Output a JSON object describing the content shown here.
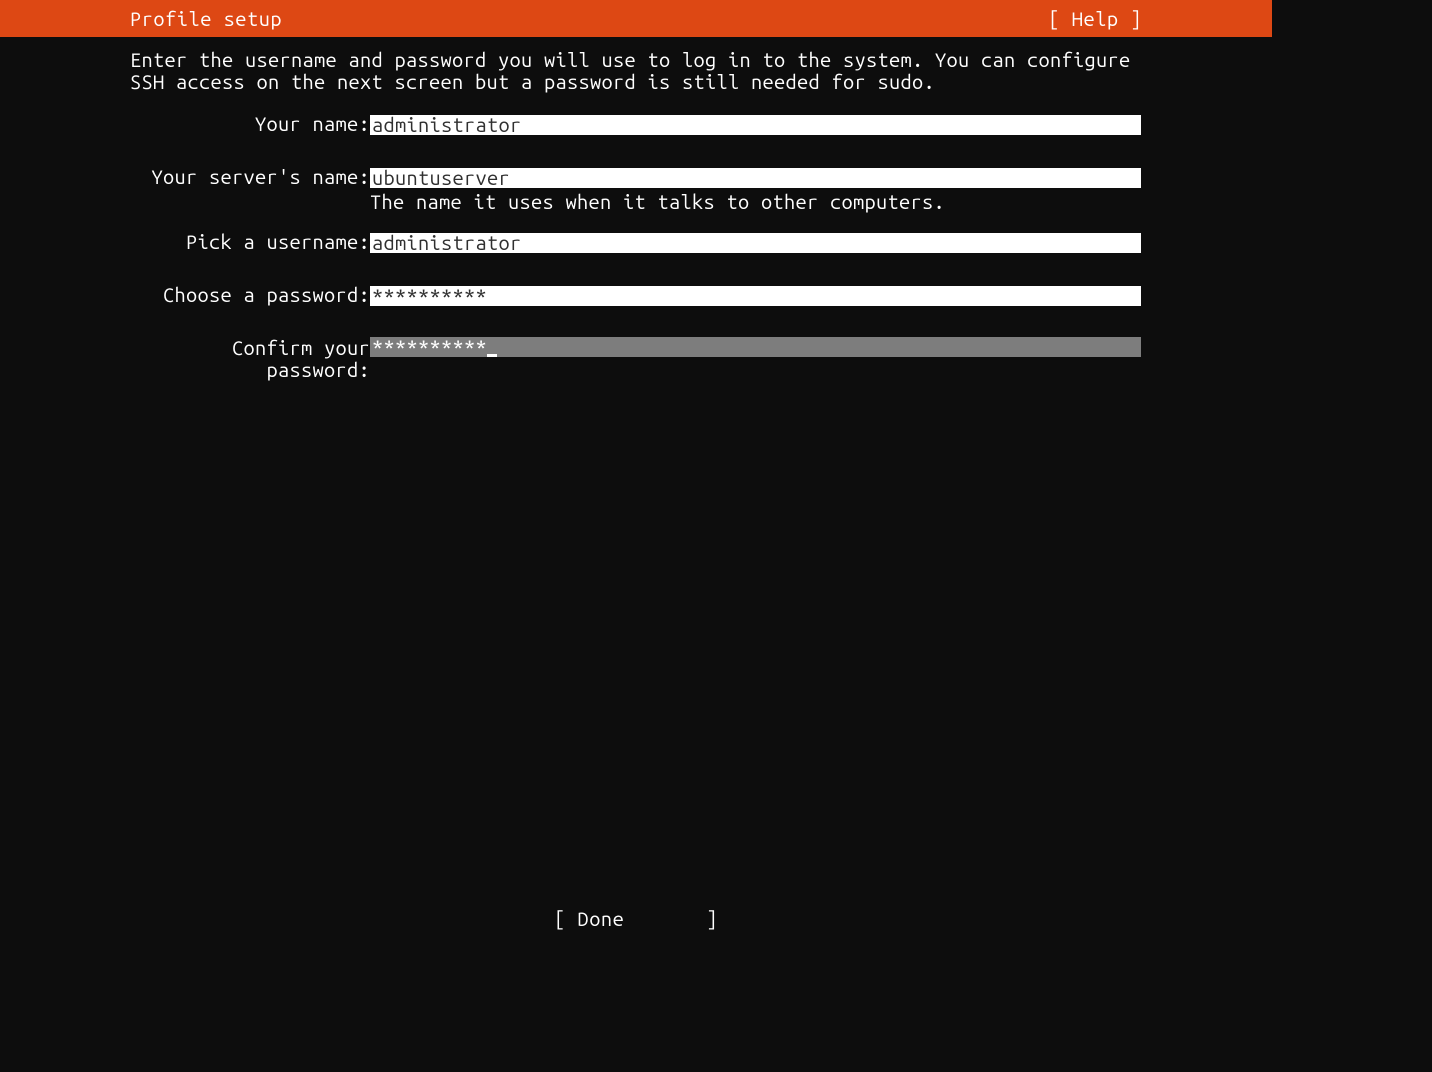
{
  "header": {
    "title": "Profile setup",
    "help": "[ Help ]"
  },
  "description": "Enter the username and password you will use to log in to the system. You can configure SSH access on the next screen but a password is still needed for sudo.",
  "form": {
    "name": {
      "label": "Your name:",
      "value": "administrator"
    },
    "server": {
      "label": "Your server's name:",
      "value": "ubuntuserver",
      "hint": "The name it uses when it talks to other computers."
    },
    "username": {
      "label": "Pick a username:",
      "value": "administrator"
    },
    "password": {
      "label": "Choose a password:",
      "value": "**********"
    },
    "confirm": {
      "label": "Confirm your password:",
      "value": "**********"
    }
  },
  "footer": {
    "done": "[ Done       ]"
  }
}
